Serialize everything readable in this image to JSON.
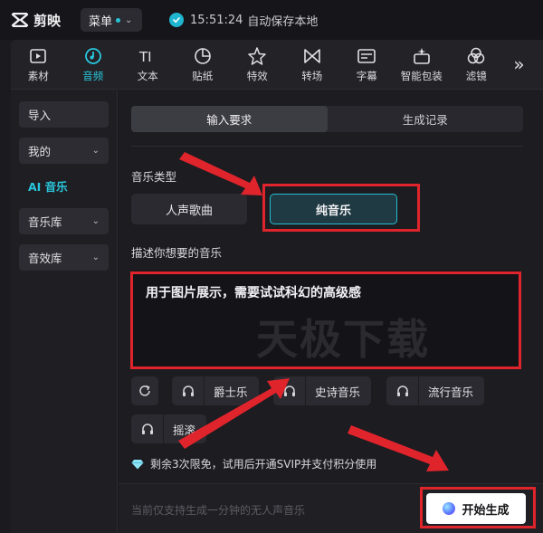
{
  "app": {
    "name": "剪映"
  },
  "header": {
    "menu_label": "菜单",
    "save_time": "15:51:24",
    "save_text": "自动保存本地"
  },
  "toolbar": {
    "tabs": [
      {
        "label": "素材",
        "icon": "media-icon",
        "active": false
      },
      {
        "label": "音频",
        "icon": "audio-icon",
        "active": true
      },
      {
        "label": "文本",
        "icon": "text-icon",
        "active": false
      },
      {
        "label": "贴纸",
        "icon": "sticker-icon",
        "active": false
      },
      {
        "label": "特效",
        "icon": "effects-icon",
        "active": false
      },
      {
        "label": "转场",
        "icon": "transition-icon",
        "active": false
      },
      {
        "label": "字幕",
        "icon": "subtitle-icon",
        "active": false
      },
      {
        "label": "智能包装",
        "icon": "smart-pack-icon",
        "active": false
      },
      {
        "label": "滤镜",
        "icon": "filter-icon",
        "active": false
      }
    ],
    "more_label": "»",
    "accent": "#29c7dc"
  },
  "sidebar": {
    "items": [
      {
        "label": "导入",
        "has_chevron": false
      },
      {
        "label": "我的",
        "has_chevron": true
      },
      {
        "label": "AI 音乐",
        "has_chevron": false,
        "active": true
      },
      {
        "label": "音乐库",
        "has_chevron": true
      },
      {
        "label": "音效库",
        "has_chevron": true
      }
    ]
  },
  "main": {
    "tabs": [
      {
        "label": "输入要求",
        "active": true
      },
      {
        "label": "生成记录",
        "active": false
      }
    ],
    "music_type_label": "音乐类型",
    "music_types": [
      {
        "label": "人声歌曲",
        "selected": false
      },
      {
        "label": "纯音乐",
        "selected": true
      }
    ],
    "describe_label": "描述你想要的音乐",
    "description_value": "用于图片展示，需要试试科幻的高级感",
    "watermark": "天极下载",
    "style_chips": [
      {
        "label": "爵士乐",
        "icon": "headphones-icon"
      },
      {
        "label": "史诗音乐",
        "icon": "headphones-icon"
      },
      {
        "label": "流行音乐",
        "icon": "headphones-icon"
      },
      {
        "label": "摇滚",
        "icon": "headphones-icon"
      }
    ],
    "quota_text": "剩余3次限免，试用后开通SVIP并支付积分使用",
    "footer_note": "当前仅支持生成一分钟的无人声音乐",
    "start_button": "开始生成"
  },
  "colors": {
    "accent": "#29c7dc",
    "annotation_red": "#e0242c",
    "background": "#1a1a1f"
  }
}
